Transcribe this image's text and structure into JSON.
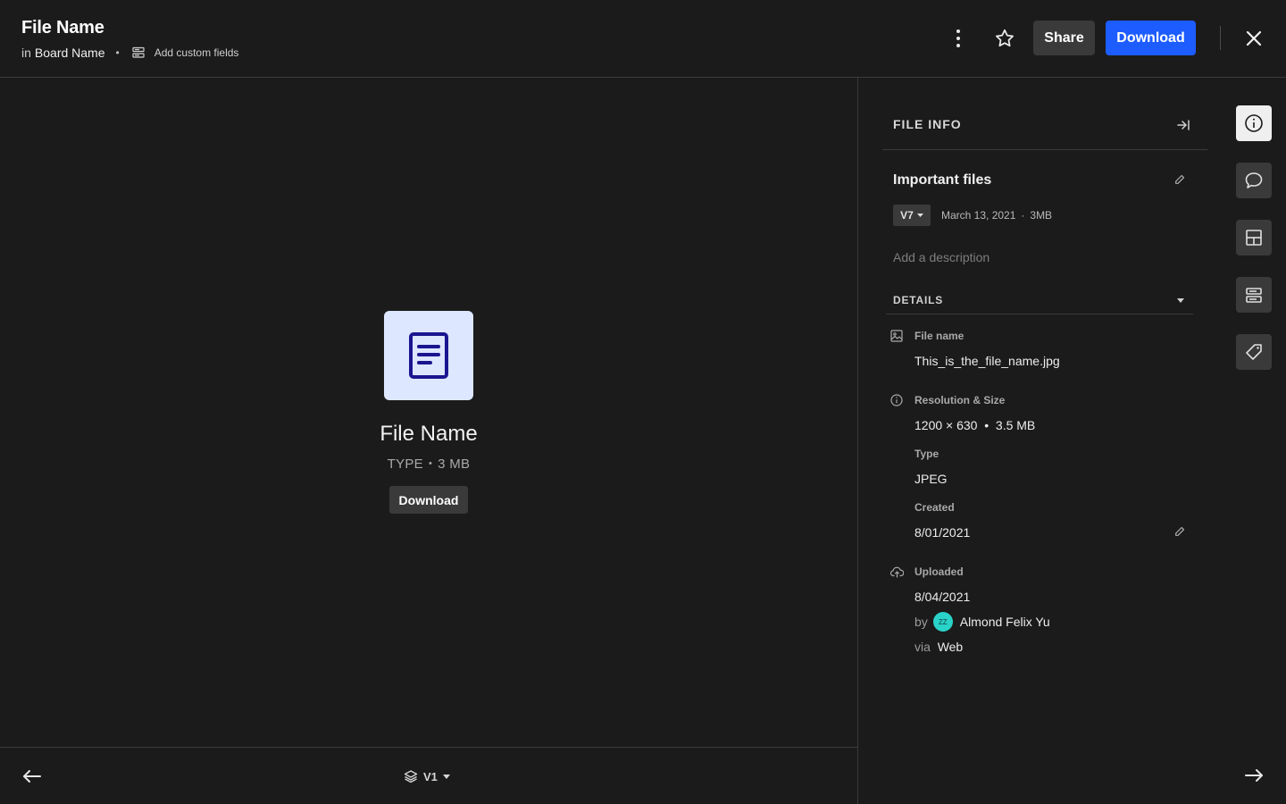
{
  "header": {
    "title": "File Name",
    "in_prefix": "in",
    "board_name": "Board Name",
    "separator": "•",
    "custom_fields_label": "Add custom fields",
    "share_label": "Share",
    "download_label": "Download"
  },
  "preview": {
    "file_name": "File Name",
    "file_type": "TYPE",
    "meta_separator": "•",
    "file_size": "3 MB",
    "download_label": "Download"
  },
  "footer": {
    "version_label": "V1"
  },
  "panel": {
    "title": "FILE INFO",
    "group_name": "Important files",
    "version": "V7",
    "date": "March 13, 2021",
    "info_separator": "·",
    "size": "3MB",
    "description_placeholder": "Add a description",
    "details_title": "DETAILS",
    "details": {
      "file_name_label": "File name",
      "file_name_value": "This_is_the_file_name.jpg",
      "resolution_label": "Resolution & Size",
      "resolution_value": "1200 × 630  •  3.5 MB",
      "type_label": "Type",
      "type_value": "JPEG",
      "created_label": "Created",
      "created_value": "8/01/2021",
      "uploaded_label": "Uploaded",
      "uploaded_value": "8/04/2021",
      "by_label": "by",
      "avatar_initials": "ZZ",
      "uploader_name": "Almond Felix Yu",
      "via_label": "via",
      "via_value": "Web"
    }
  },
  "colors": {
    "background": "#1b1b1b",
    "primary": "#1d5dff",
    "secondary_button": "#3a3a3a",
    "file_tile": "#dde7ff",
    "file_icon": "#1a1690",
    "avatar": "#2ad3c9"
  },
  "icons": {
    "rail": [
      "info-icon",
      "comment-icon",
      "layout-icon",
      "custom-fields-icon",
      "tag-icon"
    ]
  }
}
